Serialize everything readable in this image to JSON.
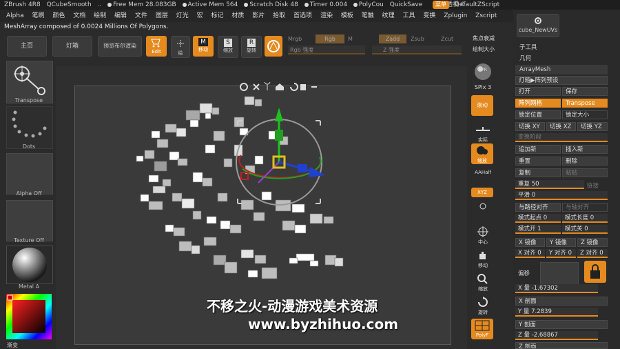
{
  "titlebar": {
    "items": [
      "ZBrush 4R8",
      "QCubeSmooth",
      "..",
      "Free Mem 28.083GB",
      "Active Mem 564",
      "Scratch Disk 48",
      "Timer 0.004",
      "PolyCou",
      "QuickSave",
      "透视 0",
      "菜单",
      "DefaultZScript"
    ]
  },
  "menubar": {
    "items": [
      "Alpha",
      "笔刷",
      "颜色",
      "文档",
      "绘制",
      "编辑",
      "文件",
      "图层",
      "灯光",
      "宏",
      "标记",
      "材质",
      "影片",
      "拾取",
      "首选项",
      "渲染",
      "模板",
      "笔触",
      "纹理",
      "工具",
      "变换",
      "Zplugin",
      "Zscript"
    ]
  },
  "status_text": "MeshArray composed of 0.0024 Millions Of Polygons.",
  "toolbar": {
    "home": "主页",
    "lightbox": "灯箱",
    "preview": "预览布尔渲染",
    "edit": "Edit",
    "draw": "绘",
    "move": "移动",
    "scale": "缩放",
    "rotate": "旋转",
    "mrgb": "Mrgb",
    "rgb": "Rgb",
    "m": "M",
    "zadd": "Zadd",
    "zsub": "Zsub",
    "zcut": "Zcut",
    "rgb_intensity": "Rgb 强度",
    "z_intensity": "Z 强度",
    "focal_shift": "焦点衰减",
    "draw_size": "绘制大小"
  },
  "leftshelf": {
    "transpose": "Transpose",
    "dots": "Dots",
    "alpha_off": "Alpha Off",
    "texture_off": "Texture Off",
    "metal": "Metal A",
    "gradient": "渐变"
  },
  "rightshelf": {
    "bpr": "BPR",
    "spix": "SPix 3",
    "scroll": "滚动",
    "actual": "实际",
    "zoom": "缩放",
    "aahalf": "AAHalf",
    "persp": "透视",
    "floor": "地网格",
    "local": "局部",
    "xyz": "XYZ",
    "frame": "中心",
    "move": "移动",
    "scale": "缩放",
    "rotate": "旋转",
    "polyf": "PolyF"
  },
  "rpanel": {
    "tool_name": "cube_NewUVs",
    "subtool": "子工具",
    "geometry": "几何",
    "arraymesh": "ArrayMesh",
    "lightbox_preset": "灯箱▶阵列预设",
    "open": "打开",
    "save": "保存",
    "array_mesh": "阵列网格",
    "transpose": "Transpose",
    "lock_position": "锁定位置",
    "lock_size": "锁定大小",
    "switch_xy": "切换 XY",
    "switch_xz": "切换 XZ",
    "switch_yz": "切换 YZ",
    "transform_stage": "变换阶段",
    "append_new": "追加新",
    "insert_new": "插入新",
    "reset": "重置",
    "delete": "删除",
    "copy": "复制",
    "paste": "粘贴",
    "repeat_label": "重复",
    "repeat_value": "50",
    "chain": "链接",
    "smooth_label": "平滑",
    "smooth_value": "0",
    "align_path": "与路径对齐",
    "align_to": "与轴对齐",
    "pattern_start_label": "模式起点",
    "pattern_start_value": "0",
    "pattern_length_label": "模式长度",
    "pattern_length_value": "0",
    "pattern_on_label": "模式开",
    "pattern_on_value": "1",
    "pattern_off_label": "模式关",
    "pattern_off_value": "0",
    "x_mirror": "X 镜像",
    "y_mirror": "Y 镜像",
    "z_mirror": "Z 镜像",
    "x_align_label": "X 对齐",
    "x_align_value": "0",
    "y_align_label": "Y 对齐",
    "y_align_value": "0",
    "z_align_label": "Z 对齐",
    "z_align_value": "0",
    "offset": "偏移",
    "x_amount_label": "X 量",
    "x_amount_value": "-1.67302",
    "x_profile": "X 剖面",
    "y_amount_label": "Y 量",
    "y_amount_value": "7.2839",
    "y_profile": "Y 剖面",
    "z_amount_label": "Z 量",
    "z_amount_value": "-2.68867",
    "z_profile": "Z 剖面"
  },
  "watermark": {
    "line1": "不移之火-动漫游戏美术资源",
    "line2": "www.byzhihuo.com"
  },
  "colors": {
    "accent": "#e58a1f",
    "bg": "#2b2b2b"
  }
}
